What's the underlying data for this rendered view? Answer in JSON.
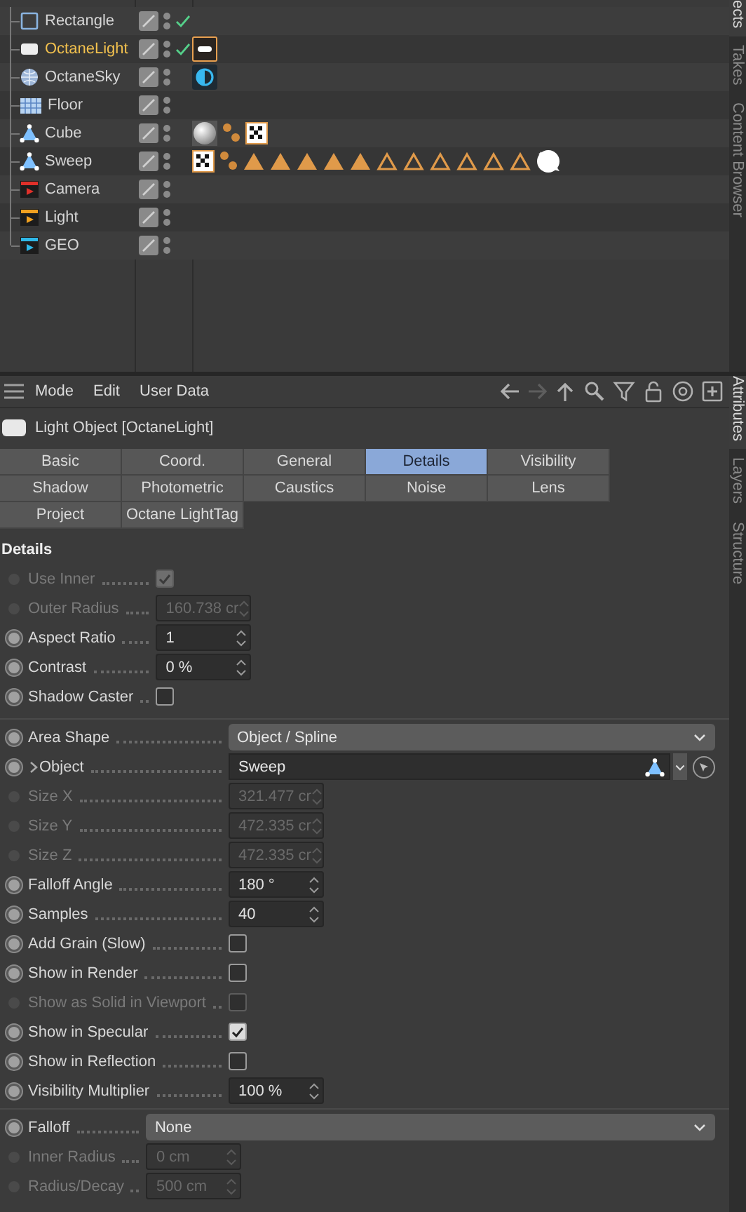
{
  "object_manager": {
    "objects": [
      {
        "name": "Rectangle",
        "kind": "rectangle",
        "selected": false,
        "checked": true
      },
      {
        "name": "OctaneLight",
        "kind": "light-object",
        "selected": true,
        "checked": true,
        "tags": [
          {
            "kind": "light-tag"
          }
        ]
      },
      {
        "name": "OctaneSky",
        "kind": "sky",
        "selected": false,
        "checked": false,
        "tags": [
          {
            "kind": "sky-tag"
          }
        ]
      },
      {
        "name": "Floor",
        "kind": "floor",
        "selected": false,
        "checked": false
      },
      {
        "name": "Cube",
        "kind": "polygon",
        "selected": false,
        "checked": false,
        "tags": [
          {
            "kind": "sphere"
          },
          {
            "kind": "dots"
          },
          {
            "kind": "checker"
          }
        ]
      },
      {
        "name": "Sweep",
        "kind": "polygon",
        "selected": false,
        "checked": false,
        "tags": [
          {
            "kind": "checker"
          },
          {
            "kind": "dots"
          },
          {
            "kind": "triangle"
          },
          {
            "kind": "triangle"
          },
          {
            "kind": "triangle"
          },
          {
            "kind": "triangle"
          },
          {
            "kind": "triangle"
          },
          {
            "kind": "triangle-outline"
          },
          {
            "kind": "triangle-outline"
          },
          {
            "kind": "triangle-outline"
          },
          {
            "kind": "triangle-outline"
          },
          {
            "kind": "triangle-outline"
          },
          {
            "kind": "triangle-outline"
          },
          {
            "kind": "blob"
          }
        ]
      },
      {
        "name": "Camera",
        "kind": "camera",
        "selected": false,
        "checked": false
      },
      {
        "name": "Light",
        "kind": "light",
        "selected": false,
        "checked": false
      },
      {
        "name": "GEO",
        "kind": "group",
        "selected": false,
        "checked": false
      }
    ]
  },
  "side_tabs_top": [
    {
      "label": "ects",
      "selected": true
    },
    {
      "label": "Takes",
      "selected": false
    },
    {
      "label": "Content Browser",
      "selected": false
    }
  ],
  "attributes": {
    "menu": [
      "Mode",
      "Edit",
      "User Data"
    ],
    "title": "Light Object [OctaneLight]",
    "tabs": [
      {
        "label": "Basic",
        "selected": false
      },
      {
        "label": "Coord.",
        "selected": false
      },
      {
        "label": "General",
        "selected": false
      },
      {
        "label": "Details",
        "selected": true
      },
      {
        "label": "Visibility",
        "selected": false
      },
      {
        "label": "Shadow",
        "selected": false
      },
      {
        "label": "Photometric",
        "selected": false
      },
      {
        "label": "Caustics",
        "selected": false
      },
      {
        "label": "Noise",
        "selected": false
      },
      {
        "label": "Lens",
        "selected": false
      },
      {
        "label": "Project",
        "selected": false
      },
      {
        "label": "Octane LightTag",
        "selected": false
      }
    ],
    "heading": "Details",
    "sections": [
      {
        "rows": [
          {
            "kind": "checkbox",
            "label": "Use Inner",
            "disabled": true,
            "checked": true
          },
          {
            "kind": "number",
            "label": "Outer Radius",
            "disabled": true,
            "value": "160.738 cr"
          },
          {
            "kind": "number",
            "label": "Aspect Ratio",
            "disabled": false,
            "value": "1"
          },
          {
            "kind": "number",
            "label": "Contrast",
            "disabled": false,
            "value": "0 %"
          },
          {
            "kind": "checkbox",
            "label": "Shadow Caster",
            "disabled": false,
            "checked": false
          }
        ]
      },
      {
        "rows": [
          {
            "kind": "dropdown",
            "label": "Area Shape",
            "disabled": false,
            "value": "Object / Spline"
          },
          {
            "kind": "link",
            "label": "Object",
            "disabled": false,
            "value": "Sweep"
          },
          {
            "kind": "number",
            "label": "Size X",
            "disabled": true,
            "value": "321.477 cr"
          },
          {
            "kind": "number",
            "label": "Size Y",
            "disabled": true,
            "value": "472.335 cr"
          },
          {
            "kind": "number",
            "label": "Size Z",
            "disabled": true,
            "value": "472.335 cr"
          },
          {
            "kind": "number",
            "label": "Falloff Angle",
            "disabled": false,
            "value": "180 °"
          },
          {
            "kind": "number",
            "label": "Samples",
            "disabled": false,
            "value": "40"
          },
          {
            "kind": "checkbox",
            "label": "Add Grain (Slow)",
            "disabled": false,
            "checked": false
          },
          {
            "kind": "checkbox",
            "label": "Show in Render",
            "disabled": false,
            "checked": false
          },
          {
            "kind": "checkbox",
            "label": "Show as Solid in Viewport",
            "disabled": true,
            "checked": false
          },
          {
            "kind": "checkbox",
            "label": "Show in Specular",
            "disabled": false,
            "checked": true
          },
          {
            "kind": "checkbox",
            "label": "Show in Reflection",
            "disabled": false,
            "checked": false
          },
          {
            "kind": "number",
            "label": "Visibility Multiplier",
            "disabled": false,
            "value": "100 %"
          }
        ]
      },
      {
        "rows": [
          {
            "kind": "dropdown",
            "label": "Falloff",
            "disabled": false,
            "value": "None"
          },
          {
            "kind": "number",
            "label": "Inner Radius",
            "disabled": true,
            "value": "0 cm"
          },
          {
            "kind": "number",
            "label": "Radius/Decay",
            "disabled": true,
            "value": "500 cm"
          }
        ]
      }
    ]
  },
  "side_tabs_bottom": [
    {
      "label": "Attributes",
      "selected": true
    },
    {
      "label": "Layers",
      "selected": false
    },
    {
      "label": "Structure",
      "selected": false
    }
  ]
}
